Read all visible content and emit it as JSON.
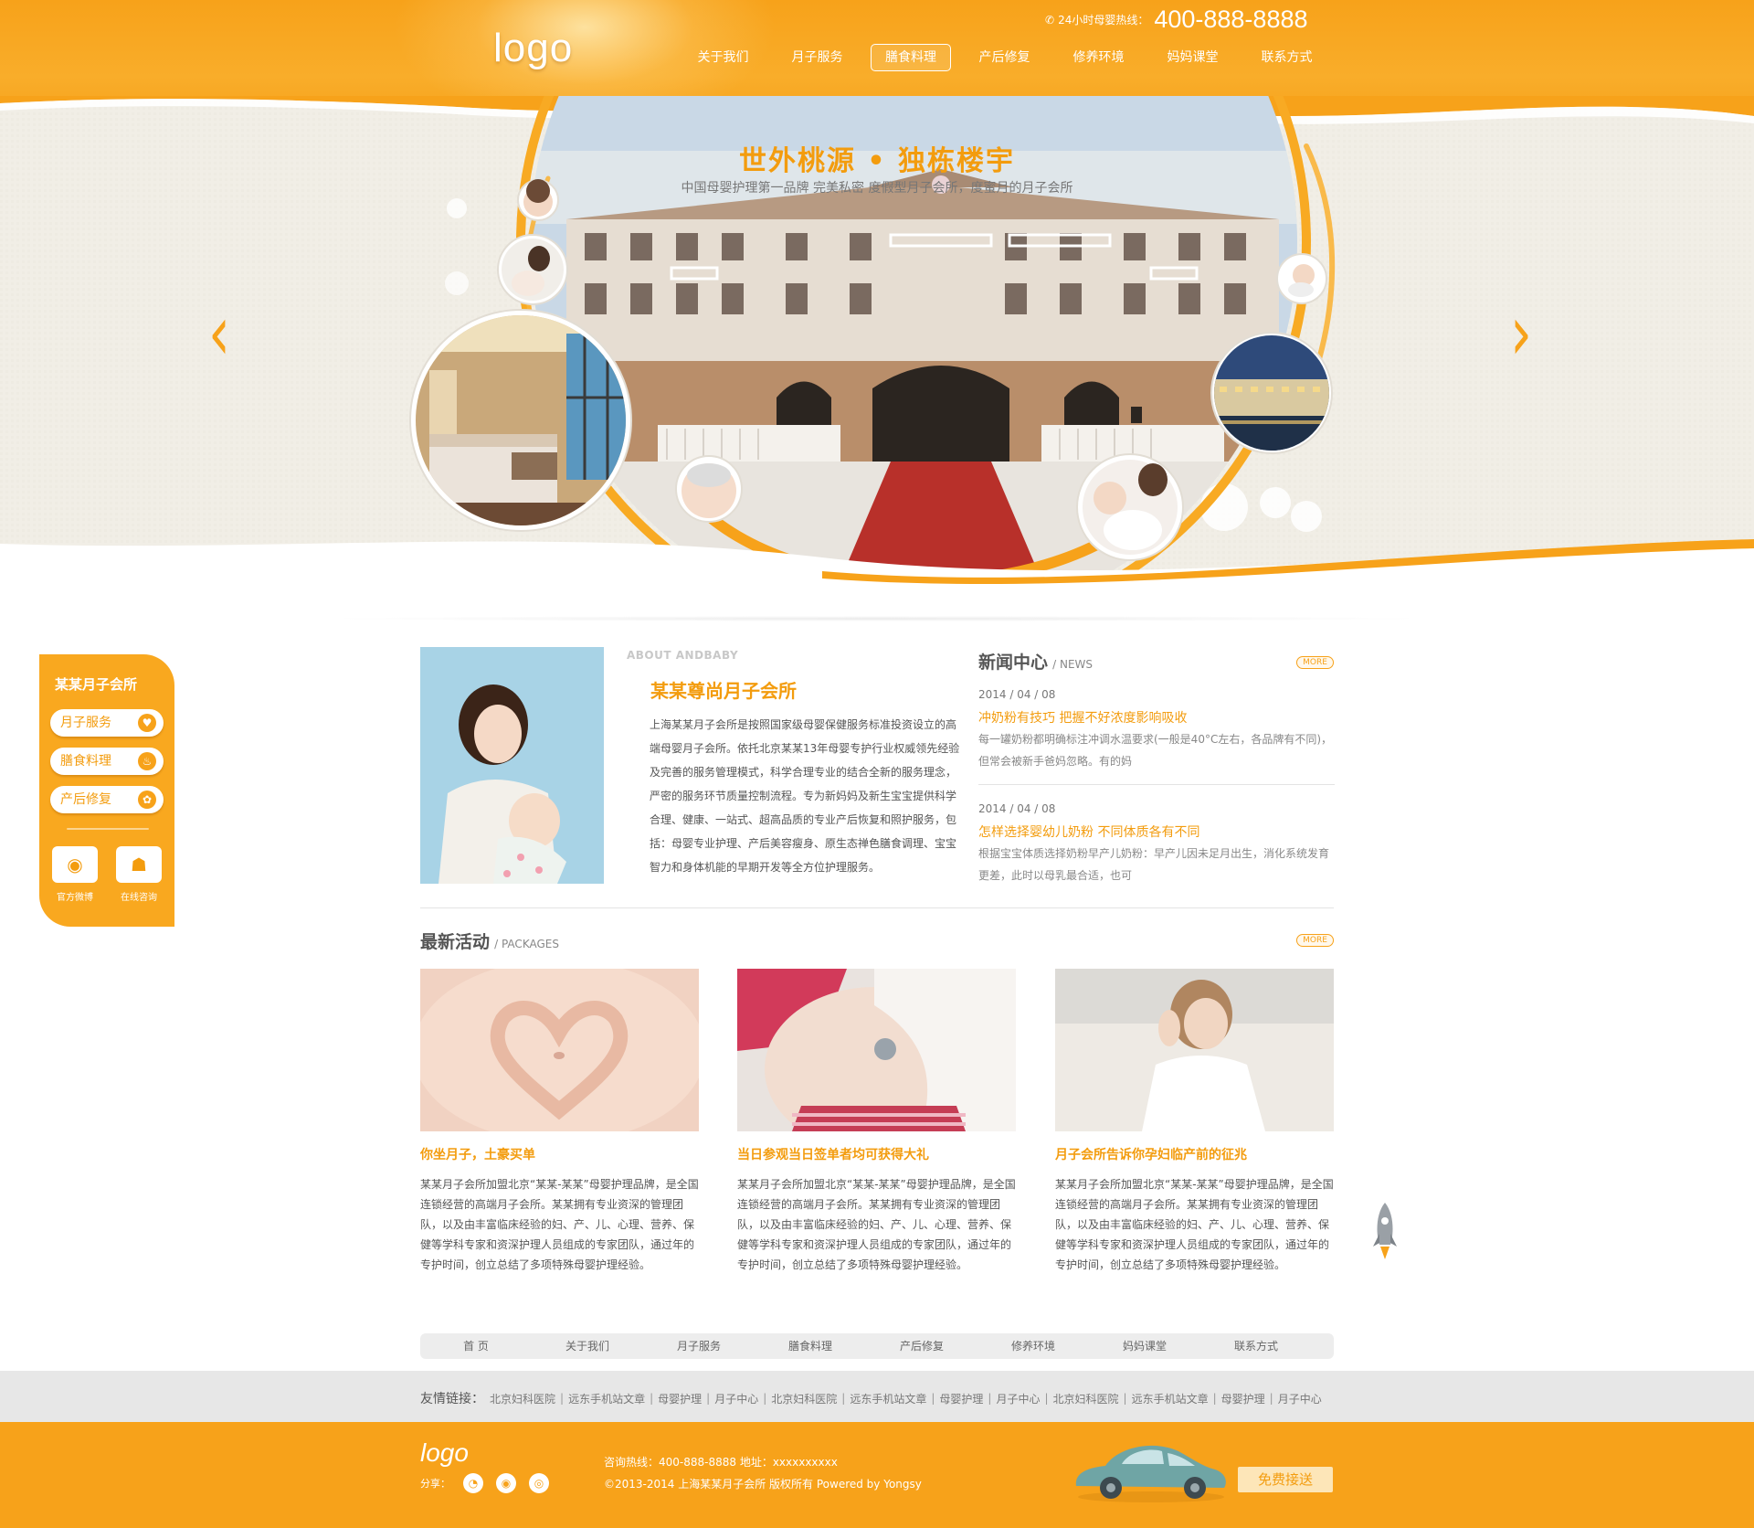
{
  "header": {
    "logo": "logo",
    "hotline_label": "24小时母婴热线：",
    "hotline_number": "400-888-8888",
    "nav": [
      {
        "label": "关于我们"
      },
      {
        "label": "月子服务"
      },
      {
        "label": "膳食料理",
        "active": true
      },
      {
        "label": "产后修复"
      },
      {
        "label": "修养环境"
      },
      {
        "label": "妈妈课堂"
      },
      {
        "label": "联系方式"
      }
    ]
  },
  "banner": {
    "title": "世外桃源 • 独栋楼宇",
    "subtitle": "中国母婴护理第一品牌   完美私密 度假型月子会所，度蜜月的月子会所"
  },
  "sidebar": {
    "title": "某某月子会所",
    "buttons": [
      {
        "label": "月子服务",
        "icon": "mother-baby-icon"
      },
      {
        "label": "膳食料理",
        "icon": "bottle-icon"
      },
      {
        "label": "产后修复",
        "icon": "yoga-icon"
      }
    ],
    "social": [
      {
        "label": "官方微博",
        "icon": "weibo-icon"
      },
      {
        "label": "在线咨询",
        "icon": "qq-icon"
      }
    ]
  },
  "about": {
    "en_title": "ABOUT ANDBABY",
    "title": "某某尊尚月子会所",
    "text": "上海某某月子会所是按照国家级母婴保健服务标准投资设立的高端母婴月子会所。依托北京某某13年母婴专护行业权威领先经验及完善的服务管理模式，科学合理专业的结合全新的服务理念，严密的服务环节质量控制流程。专为新妈妈及新生宝宝提供科学合理、健康、一站式、超高品质的专业产后恢复和照护服务，包括：母婴专业护理、产后美容瘦身、原生态禅色膳食调理、宝宝智力和身体机能的早期开发等全方位护理服务。"
  },
  "news": {
    "title": "新闻中心",
    "en_title": "/ NEWS",
    "more": "MORE",
    "items": [
      {
        "date": "2014 / 04 / 08",
        "title": "冲奶粉有技巧 把握不好浓度影响吸收",
        "text": "每一罐奶粉都明确标注冲调水温要求(一般是40°C左右，各品牌有不同)，但常会被新手爸妈忽略。有的妈"
      },
      {
        "date": "2014 / 04 / 08",
        "title": "怎样选择婴幼儿奶粉 不同体质各有不同",
        "text": "根据宝宝体质选择奶粉早产儿奶粉：早产儿因未足月出生，消化系统发育更差，此时以母乳最合适，也可"
      }
    ]
  },
  "packages": {
    "title": "最新活动",
    "en_title": "/ PACKAGES",
    "more": "MORE",
    "items": [
      {
        "title": "你坐月子，土豪买单",
        "text": "某某月子会所加盟北京“某某-某某”母婴护理品牌，是全国连锁经营的高端月子会所。某某拥有专业资深的管理团队，以及由丰富临床经验的妇、产、儿、心理、营养、保健等学科专家和资深护理人员组成的专家团队，通过年的专护时间，创立总结了多项特殊母婴护理经验。"
      },
      {
        "title": "当日参观当日签单者均可获得大礼",
        "text": "某某月子会所加盟北京“某某-某某”母婴护理品牌，是全国连锁经营的高端月子会所。某某拥有专业资深的管理团队，以及由丰富临床经验的妇、产、儿、心理、营养、保健等学科专家和资深护理人员组成的专家团队，通过年的专护时间，创立总结了多项特殊母婴护理经验。"
      },
      {
        "title": "月子会所告诉你孕妇临产前的征兆",
        "text": "某某月子会所加盟北京“某某-某某”母婴护理品牌，是全国连锁经营的高端月子会所。某某拥有专业资深的管理团队，以及由丰富临床经验的妇、产、儿、心理、营养、保健等学科专家和资深护理人员组成的专家团队，通过年的专护时间，创立总结了多项特殊母婴护理经验。"
      }
    ]
  },
  "bottom_nav": [
    "首 页",
    "关于我们",
    "月子服务",
    "膳食料理",
    "产后修复",
    "修养环境",
    "妈妈课堂",
    "联系方式"
  ],
  "friend_links": {
    "label": "友情链接：",
    "links": [
      "北京妇科医院",
      "远东手机站文章",
      "母婴护理",
      "月子中心",
      "北京妇科医院",
      "远东手机站文章",
      "母婴护理",
      "月子中心",
      "北京妇科医院",
      "远东手机站文章",
      "母婴护理",
      "月子中心"
    ]
  },
  "footer": {
    "logo": "logo",
    "share_label": "分享：",
    "share_icons": [
      "weixin-icon",
      "weibo-icon",
      "qzone-icon"
    ],
    "contact_line1": "咨询热线：400-888-8888   地址：xxxxxxxxxx",
    "contact_line2": "©2013-2014 上海某某月子会所  版权所有 Powered by Yongsy",
    "pickup": "免费接送"
  },
  "colors": {
    "accent": "#f7a21a",
    "accent_text": "#f39c0e",
    "banner_bg": "#f1efe8"
  }
}
